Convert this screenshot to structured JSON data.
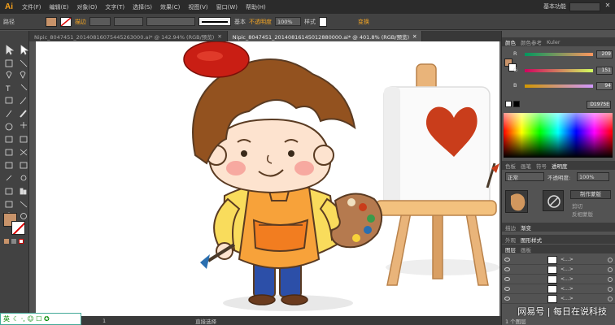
{
  "app": {
    "logo": "Ai",
    "menu": [
      "文件(F)",
      "编辑(E)",
      "对象(O)",
      "文字(T)",
      "选择(S)",
      "效果(C)",
      "视图(V)",
      "窗口(W)",
      "帮助(H)"
    ],
    "workspace": "基本功能",
    "win_close": "✕"
  },
  "control": {
    "path_label": "路径",
    "stroke_label": "描边",
    "stroke_style": "基本",
    "opacity_label": "不透明度",
    "opacity_value": "100%",
    "style_label": "样式",
    "shape_label": "变换",
    "fill_color": "#c8936a"
  },
  "tabs": [
    {
      "label": "Nipic_8047451_20140816075445263000.ai* @ 142.94% (RGB/预览)",
      "close": "✕",
      "active": false
    },
    {
      "label": "Nipic_8047451_20140816145012880000.ai* @ 401.8% (RGB/预览)",
      "close": "✕",
      "active": true
    }
  ],
  "status": {
    "nav": "1",
    "mode": "直接选择"
  },
  "ime": {
    "lang": "英",
    "icons": "☾ ·, ☺ ☐ ✪"
  },
  "color_panel": {
    "tabs": [
      "颜色",
      "颜色参考",
      "Kuler"
    ],
    "channels": [
      {
        "label": "R",
        "value": "209"
      },
      {
        "label": "G",
        "value": "151"
      },
      {
        "label": "B",
        "value": "94"
      }
    ],
    "hex": "D1975E"
  },
  "swatch_tabs": [
    "色板",
    "画笔",
    "符号"
  ],
  "transparency": {
    "title": "透明度",
    "mode": "正常",
    "opacity_label": "不透明度:",
    "opacity_value": "100%",
    "make_mask": "制作蒙版",
    "clip": "剪切",
    "invert": "反相蒙版"
  },
  "appearance_tabs": [
    "描边",
    "渐变"
  ],
  "layer_tabs": [
    "外观",
    "图形样式"
  ],
  "layers_tabs": [
    "图层",
    "画板"
  ],
  "layers": [
    {
      "name": "<...>"
    },
    {
      "name": "<...>"
    },
    {
      "name": "<...>"
    },
    {
      "name": "<...>"
    },
    {
      "name": "<...>"
    }
  ],
  "layers_count": "1 个图层",
  "watermark": "网易号 | 每日在说科技"
}
